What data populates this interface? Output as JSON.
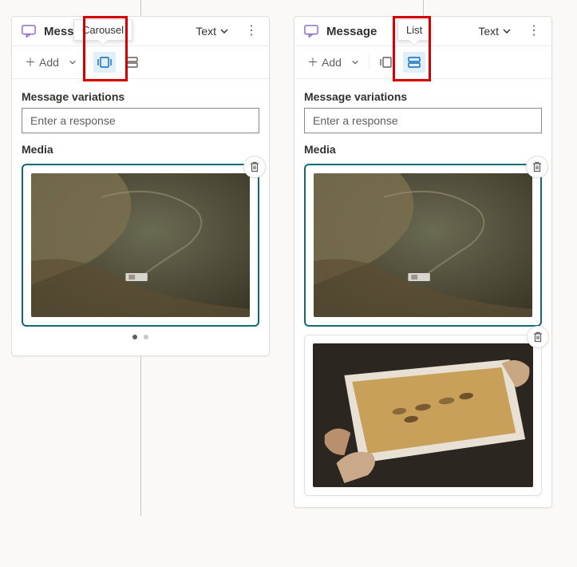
{
  "leftPanel": {
    "title": "Message",
    "tooltip": "Carousel",
    "textDropdown": "Text",
    "addLabel": "Add",
    "variationsHeading": "Message variations",
    "responsePlaceholder": "Enter a response",
    "mediaHeading": "Media",
    "layout": "carousel",
    "pager": {
      "total": 2,
      "active": 0
    }
  },
  "rightPanel": {
    "title": "Message",
    "tooltip": "List",
    "textDropdown": "Text",
    "addLabel": "Add",
    "variationsHeading": "Message variations",
    "responsePlaceholder": "Enter a response",
    "mediaHeading": "Media",
    "layout": "list"
  },
  "icons": {
    "chat": "chat-bubble",
    "chevronDown": "chevron-down",
    "more": "⋮",
    "plus": "+",
    "carousel": "carousel-layout",
    "list": "list-layout",
    "trash": "trash"
  },
  "colors": {
    "accent": "#0f6cbd",
    "selectedBorder": "#0f6c70",
    "highlightRed": "#d40000",
    "iconPurple": "#8661c5"
  }
}
